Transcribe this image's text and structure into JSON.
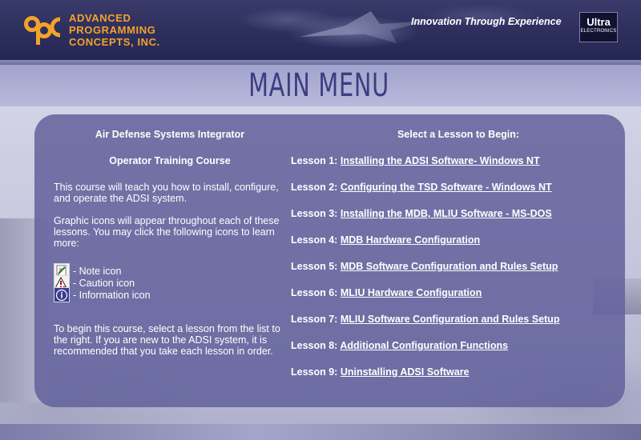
{
  "header": {
    "company_line1": "ADVANCED",
    "company_line2": "PROGRAMMING",
    "company_line3": "CONCEPTS, INC.",
    "tagline": "Innovation Through Experience",
    "partner_logo_top": "Ultra",
    "partner_logo_bottom": "ELECTRONICS",
    "logo_icon": "apc-logo-icon",
    "accent_color": "#f4a329"
  },
  "page": {
    "title": "MAIN MENU"
  },
  "left": {
    "course_title": "Air Defense Systems Integrator",
    "course_subtitle": "Operator Training Course",
    "intro": "This course will teach you how to install, configure, and operate the ADSI system.",
    "icons_text": "Graphic icons will appear throughout each of these lessons. You may click the following icons to learn more:",
    "legend": [
      {
        "icon": "note-icon",
        "label": "- Note icon"
      },
      {
        "icon": "caution-icon",
        "label": "- Caution icon"
      },
      {
        "icon": "information-icon",
        "label": "- Information icon"
      }
    ],
    "begin_text": "To begin this course, select a lesson from the list to the right. If you are new to the ADSI system, it is recommended that you take each lesson in order."
  },
  "right": {
    "heading": "Select a Lesson to Begin:",
    "lessons": [
      {
        "num": "Lesson 1:",
        "title": "Installing the ADSI Software- Windows NT"
      },
      {
        "num": "Lesson 2:",
        "title": "Configuring the TSD Software - Windows NT"
      },
      {
        "num": "Lesson 3:",
        "title": "Installing the MDB, MLIU Software - MS-DOS"
      },
      {
        "num": "Lesson 4:",
        "title": "MDB Hardware Configuration"
      },
      {
        "num": "Lesson 5:",
        "title": "MDB Software Configuration and Rules Setup"
      },
      {
        "num": "Lesson 6:",
        "title": "MLIU Hardware Configuration"
      },
      {
        "num": "Lesson 7:",
        "title": "MLIU Software Configuration and Rules Setup"
      },
      {
        "num": "Lesson 8:",
        "title": "Additional Configuration Functions"
      },
      {
        "num": "Lesson 9:",
        "title": "Uninstalling ADSI Software"
      }
    ]
  },
  "colors": {
    "header_bg": "#2d2e5c",
    "title_color": "#3c3d80",
    "panel_bg": "#62629c",
    "text": "#ffffff"
  }
}
